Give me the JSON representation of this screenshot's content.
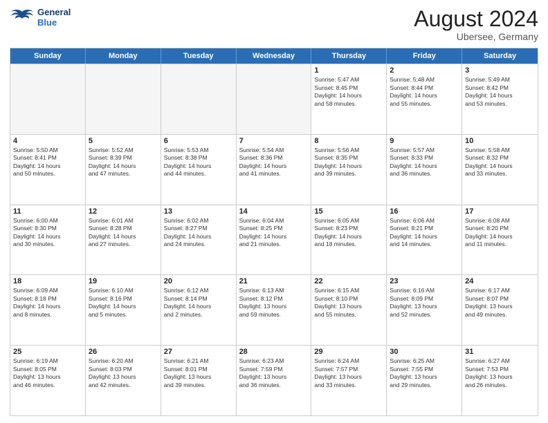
{
  "header": {
    "logo_line1": "General",
    "logo_line2": "Blue",
    "month_year": "August 2024",
    "location": "Ubersee, Germany"
  },
  "weekdays": [
    "Sunday",
    "Monday",
    "Tuesday",
    "Wednesday",
    "Thursday",
    "Friday",
    "Saturday"
  ],
  "weeks": [
    [
      {
        "day": "",
        "info": "",
        "empty": true
      },
      {
        "day": "",
        "info": "",
        "empty": true
      },
      {
        "day": "",
        "info": "",
        "empty": true
      },
      {
        "day": "",
        "info": "",
        "empty": true
      },
      {
        "day": "1",
        "info": "Sunrise: 5:47 AM\nSunset: 8:45 PM\nDaylight: 14 hours\nand 58 minutes."
      },
      {
        "day": "2",
        "info": "Sunrise: 5:48 AM\nSunset: 8:44 PM\nDaylight: 14 hours\nand 55 minutes."
      },
      {
        "day": "3",
        "info": "Sunrise: 5:49 AM\nSunset: 8:42 PM\nDaylight: 14 hours\nand 53 minutes."
      }
    ],
    [
      {
        "day": "4",
        "info": "Sunrise: 5:50 AM\nSunset: 8:41 PM\nDaylight: 14 hours\nand 50 minutes."
      },
      {
        "day": "5",
        "info": "Sunrise: 5:52 AM\nSunset: 8:39 PM\nDaylight: 14 hours\nand 47 minutes."
      },
      {
        "day": "6",
        "info": "Sunrise: 5:53 AM\nSunset: 8:38 PM\nDaylight: 14 hours\nand 44 minutes."
      },
      {
        "day": "7",
        "info": "Sunrise: 5:54 AM\nSunset: 8:36 PM\nDaylight: 14 hours\nand 41 minutes."
      },
      {
        "day": "8",
        "info": "Sunrise: 5:56 AM\nSunset: 8:35 PM\nDaylight: 14 hours\nand 39 minutes."
      },
      {
        "day": "9",
        "info": "Sunrise: 5:57 AM\nSunset: 8:33 PM\nDaylight: 14 hours\nand 36 minutes."
      },
      {
        "day": "10",
        "info": "Sunrise: 5:58 AM\nSunset: 8:32 PM\nDaylight: 14 hours\nand 33 minutes."
      }
    ],
    [
      {
        "day": "11",
        "info": "Sunrise: 6:00 AM\nSunset: 8:30 PM\nDaylight: 14 hours\nand 30 minutes."
      },
      {
        "day": "12",
        "info": "Sunrise: 6:01 AM\nSunset: 8:28 PM\nDaylight: 14 hours\nand 27 minutes."
      },
      {
        "day": "13",
        "info": "Sunrise: 6:02 AM\nSunset: 8:27 PM\nDaylight: 14 hours\nand 24 minutes."
      },
      {
        "day": "14",
        "info": "Sunrise: 6:04 AM\nSunset: 8:25 PM\nDaylight: 14 hours\nand 21 minutes."
      },
      {
        "day": "15",
        "info": "Sunrise: 6:05 AM\nSunset: 8:23 PM\nDaylight: 14 hours\nand 18 minutes."
      },
      {
        "day": "16",
        "info": "Sunrise: 6:06 AM\nSunset: 8:21 PM\nDaylight: 14 hours\nand 14 minutes."
      },
      {
        "day": "17",
        "info": "Sunrise: 6:08 AM\nSunset: 8:20 PM\nDaylight: 14 hours\nand 11 minutes."
      }
    ],
    [
      {
        "day": "18",
        "info": "Sunrise: 6:09 AM\nSunset: 8:18 PM\nDaylight: 14 hours\nand 8 minutes."
      },
      {
        "day": "19",
        "info": "Sunrise: 6:10 AM\nSunset: 8:16 PM\nDaylight: 14 hours\nand 5 minutes."
      },
      {
        "day": "20",
        "info": "Sunrise: 6:12 AM\nSunset: 8:14 PM\nDaylight: 14 hours\nand 2 minutes."
      },
      {
        "day": "21",
        "info": "Sunrise: 6:13 AM\nSunset: 8:12 PM\nDaylight: 13 hours\nand 59 minutes."
      },
      {
        "day": "22",
        "info": "Sunrise: 6:15 AM\nSunset: 8:10 PM\nDaylight: 13 hours\nand 55 minutes."
      },
      {
        "day": "23",
        "info": "Sunrise: 6:16 AM\nSunset: 8:09 PM\nDaylight: 13 hours\nand 52 minutes."
      },
      {
        "day": "24",
        "info": "Sunrise: 6:17 AM\nSunset: 8:07 PM\nDaylight: 13 hours\nand 49 minutes."
      }
    ],
    [
      {
        "day": "25",
        "info": "Sunrise: 6:19 AM\nSunset: 8:05 PM\nDaylight: 13 hours\nand 46 minutes."
      },
      {
        "day": "26",
        "info": "Sunrise: 6:20 AM\nSunset: 8:03 PM\nDaylight: 13 hours\nand 42 minutes."
      },
      {
        "day": "27",
        "info": "Sunrise: 6:21 AM\nSunset: 8:01 PM\nDaylight: 13 hours\nand 39 minutes."
      },
      {
        "day": "28",
        "info": "Sunrise: 6:23 AM\nSunset: 7:59 PM\nDaylight: 13 hours\nand 36 minutes."
      },
      {
        "day": "29",
        "info": "Sunrise: 6:24 AM\nSunset: 7:57 PM\nDaylight: 13 hours\nand 33 minutes."
      },
      {
        "day": "30",
        "info": "Sunrise: 6:25 AM\nSunset: 7:55 PM\nDaylight: 13 hours\nand 29 minutes."
      },
      {
        "day": "31",
        "info": "Sunrise: 6:27 AM\nSunset: 7:53 PM\nDaylight: 13 hours\nand 26 minutes."
      }
    ]
  ]
}
